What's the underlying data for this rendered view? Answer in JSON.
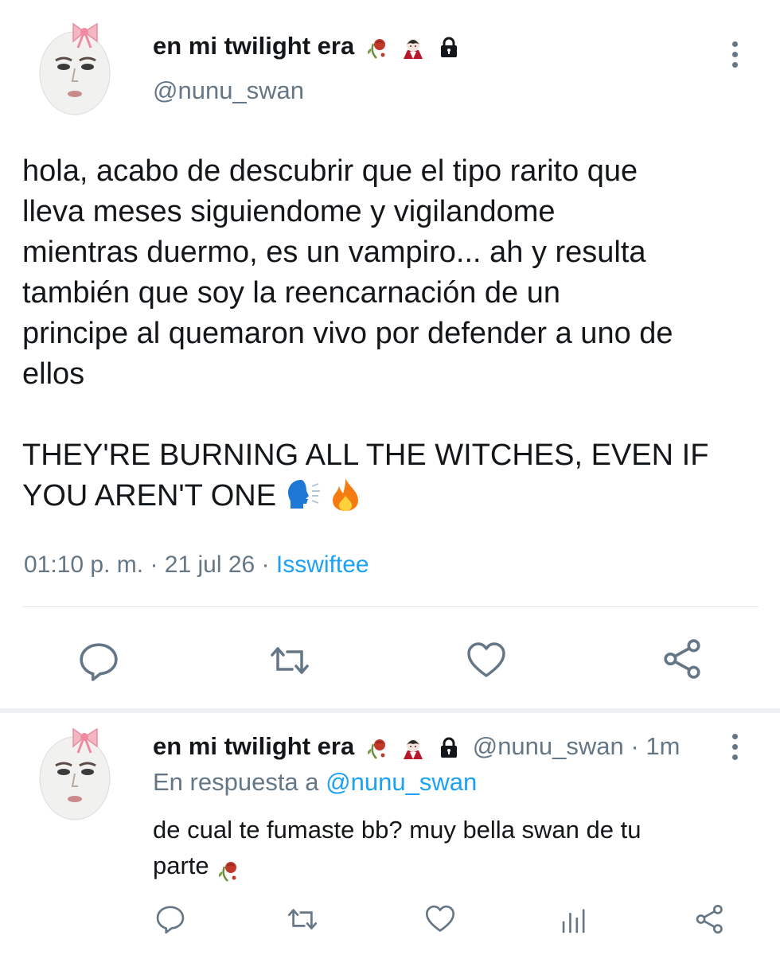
{
  "tweet": {
    "display_name": "en mi twilight era",
    "name_emojis": [
      "wilted-rose-emoji",
      "vampire-emoji",
      "lock-icon"
    ],
    "handle": "@nunu_swan",
    "text": "hola, acabo de descubrir que el tipo rarito que\nlleva meses siguiendome y vigilandome\nmientras duermo, es un vampiro... ah y resulta\ntambién que soy la reencarnación de un\nprincipe al quemaron vivo por defender a uno de\nellos\n\nTHEY'RE BURNING ALL THE WITCHES, EVEN IF\nYOU AREN'T ONE",
    "text_emojis": [
      "speaking-head-emoji",
      "fire-emoji"
    ],
    "time": "01:10 p. m.",
    "date": "21 jul 26",
    "source": "Isswiftee",
    "actions": [
      "reply-icon",
      "retweet-icon",
      "like-icon",
      "share-icon"
    ]
  },
  "reply": {
    "display_name": "en mi twilight era",
    "handle": "@nunu_swan",
    "age": "1m",
    "replying_to_label": "En respuesta a",
    "replying_to_handle": "@nunu_swan",
    "text": "de cual te fumaste bb? muy bella swan de tu\nparte",
    "actions": [
      "reply-icon",
      "retweet-icon",
      "like-icon",
      "analytics-icon",
      "share-icon"
    ]
  },
  "colors": {
    "link": "#1da1f2",
    "secondary_text": "#657786",
    "divider": "#e1e8ed"
  }
}
